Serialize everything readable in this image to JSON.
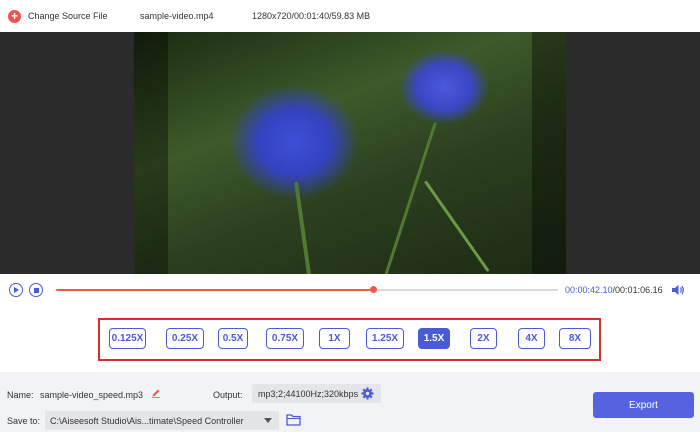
{
  "topbar": {
    "change_source_label": "Change Source File",
    "filename": "sample-video.mp4",
    "file_info": "1280x720/00:01:40/59.83 MB"
  },
  "player": {
    "current_time": "00:00:42.10",
    "total_time": "/00:01:06.16",
    "progress": 0.633
  },
  "speed": {
    "options": [
      "0.125X",
      "0.25X",
      "0.5X",
      "0.75X",
      "1X",
      "1.25X",
      "1.5X",
      "2X",
      "4X",
      "8X"
    ],
    "selected": "1.5X"
  },
  "bottom": {
    "name_label": "Name:",
    "name_value": "sample-video_speed.mp3",
    "output_label": "Output:",
    "output_value": "mp3;2;44100Hz;320kbps",
    "save_label": "Save to:",
    "save_path": "C:\\Aiseesoft Studio\\Ais...timate\\Speed Controller",
    "export_label": "Export"
  },
  "colors": {
    "accent": "#4a5bd8",
    "progress": "#f05a4a",
    "highlight_border": "#d32f2f",
    "export": "#5563e0"
  }
}
